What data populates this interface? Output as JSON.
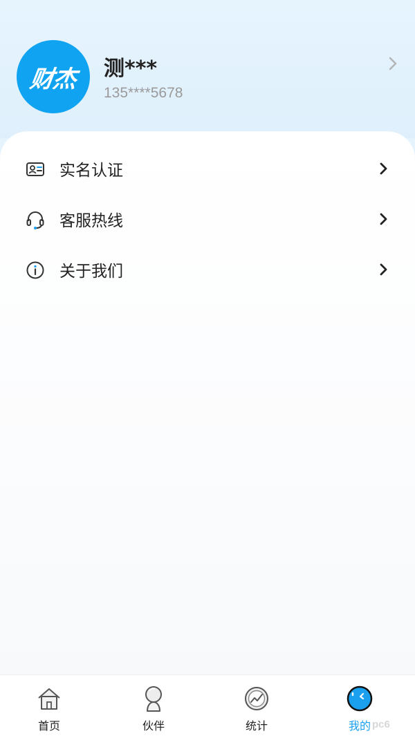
{
  "profile": {
    "avatar_text": "财杰",
    "name": "测***",
    "phone": "135****5678"
  },
  "menu": {
    "items": [
      {
        "label": "实名认证",
        "icon": "id-card-icon"
      },
      {
        "label": "客服热线",
        "icon": "headset-icon"
      },
      {
        "label": "关于我们",
        "icon": "info-icon"
      }
    ]
  },
  "tabs": [
    {
      "label": "首页",
      "icon": "home-icon",
      "active": false
    },
    {
      "label": "伙伴",
      "icon": "partner-icon",
      "active": false
    },
    {
      "label": "统计",
      "icon": "stats-icon",
      "active": false
    },
    {
      "label": "我的",
      "icon": "profile-icon",
      "active": true
    }
  ],
  "colors": {
    "accent": "#1aa0ee",
    "avatar_bg": "#0fa3f2",
    "text_primary": "#222222",
    "text_secondary": "#9a9a9a",
    "header_bg": "#e4f3fd"
  },
  "watermark": "pc6"
}
